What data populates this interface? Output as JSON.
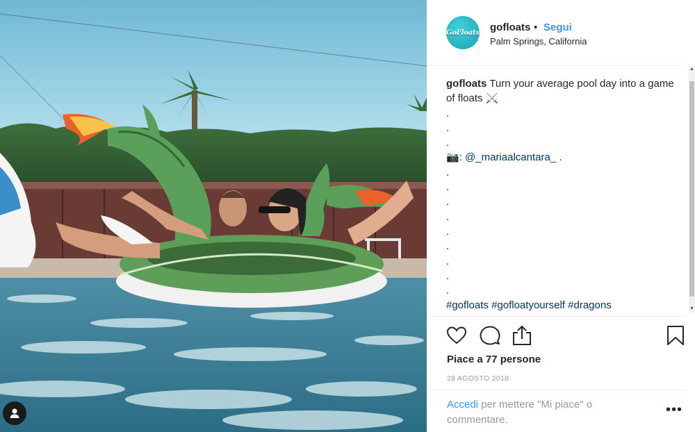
{
  "post_header": {
    "username": "gofloats",
    "separator": "•",
    "follow_label": "Segui",
    "location": "Palm Springs, California",
    "avatar_text": "GoFloats"
  },
  "caption": {
    "username": "gofloats",
    "text": "Turn your average pool day into a game of floats",
    "emoji": "⚔️",
    "dot": ".",
    "camera_emoji": "📷",
    "credit_prefix": ":",
    "mention": "@_mariaalcantara_",
    "credit_suffix": " .",
    "hashtags": [
      "#gofloats",
      "#gofloatyourself",
      "#dragons"
    ]
  },
  "actions": {
    "like_icon": "heart-icon",
    "comment_icon": "comment-icon",
    "share_icon": "share-icon",
    "save_icon": "bookmark-icon"
  },
  "likes_text": "Piace a 77 persone",
  "date_text": "28 AGOSTO 2018",
  "comment_prompt": {
    "link": "Accedi",
    "rest": " per mettere \"Mi piace\" o commentare."
  },
  "more_label": "•••",
  "colors": {
    "accent": "#3897f0",
    "hashtag": "#003569",
    "muted": "#999999",
    "text": "#262626"
  }
}
